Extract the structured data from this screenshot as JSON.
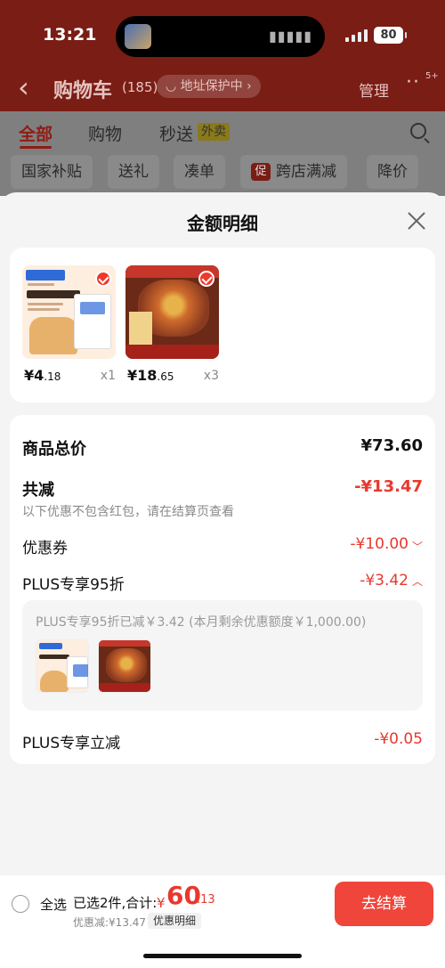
{
  "status_bar": {
    "time": "13:21",
    "battery": "80"
  },
  "nav": {
    "back_icon": "chevron-left-icon",
    "title": "购物车",
    "count": "(185)",
    "address_protect": "地址保护中",
    "manage": "管理",
    "more_badge": "5+"
  },
  "tabs": [
    {
      "label": "全部",
      "active": true
    },
    {
      "label": "购物"
    },
    {
      "label": "秒送",
      "tag": "外卖"
    }
  ],
  "chips": [
    "国家补贴",
    "送礼",
    "凑单",
    "跨店满减",
    "降价"
  ],
  "chip_promo_tag": "促",
  "sheet": {
    "title": "金额明细",
    "products": [
      {
        "price_int": "¥4",
        "price_dec": ".18",
        "qty": "x1"
      },
      {
        "price_int": "¥18",
        "price_dec": ".65",
        "qty": "x3"
      }
    ],
    "rows": {
      "total_label": "商品总价",
      "total_value": "¥73.60",
      "discount_label": "共减",
      "discount_value": "-¥13.47",
      "discount_hint": "以下优惠不包含红包，请在结算页查看",
      "coupon_label": "优惠券",
      "coupon_value": "-¥10.00",
      "plus95_label": "PLUS专享95折",
      "plus95_value": "-¥3.42",
      "plus95_detail": "PLUS专享95折已减￥3.42 (本月剩余优惠额度￥1,000.00)",
      "plus_off_label": "PLUS专享立减",
      "plus_off_value": "-¥0.05"
    }
  },
  "bottom": {
    "select_all": "全选",
    "selected": "已选2件,合计:",
    "currency": "¥",
    "total_int": "60",
    "total_dec": ".13",
    "saved": "优惠减:¥13.47",
    "detail_tag": "优惠明细",
    "checkout": "去结算"
  },
  "colors": {
    "accent": "#f0453b",
    "price_red": "#e8382e"
  }
}
